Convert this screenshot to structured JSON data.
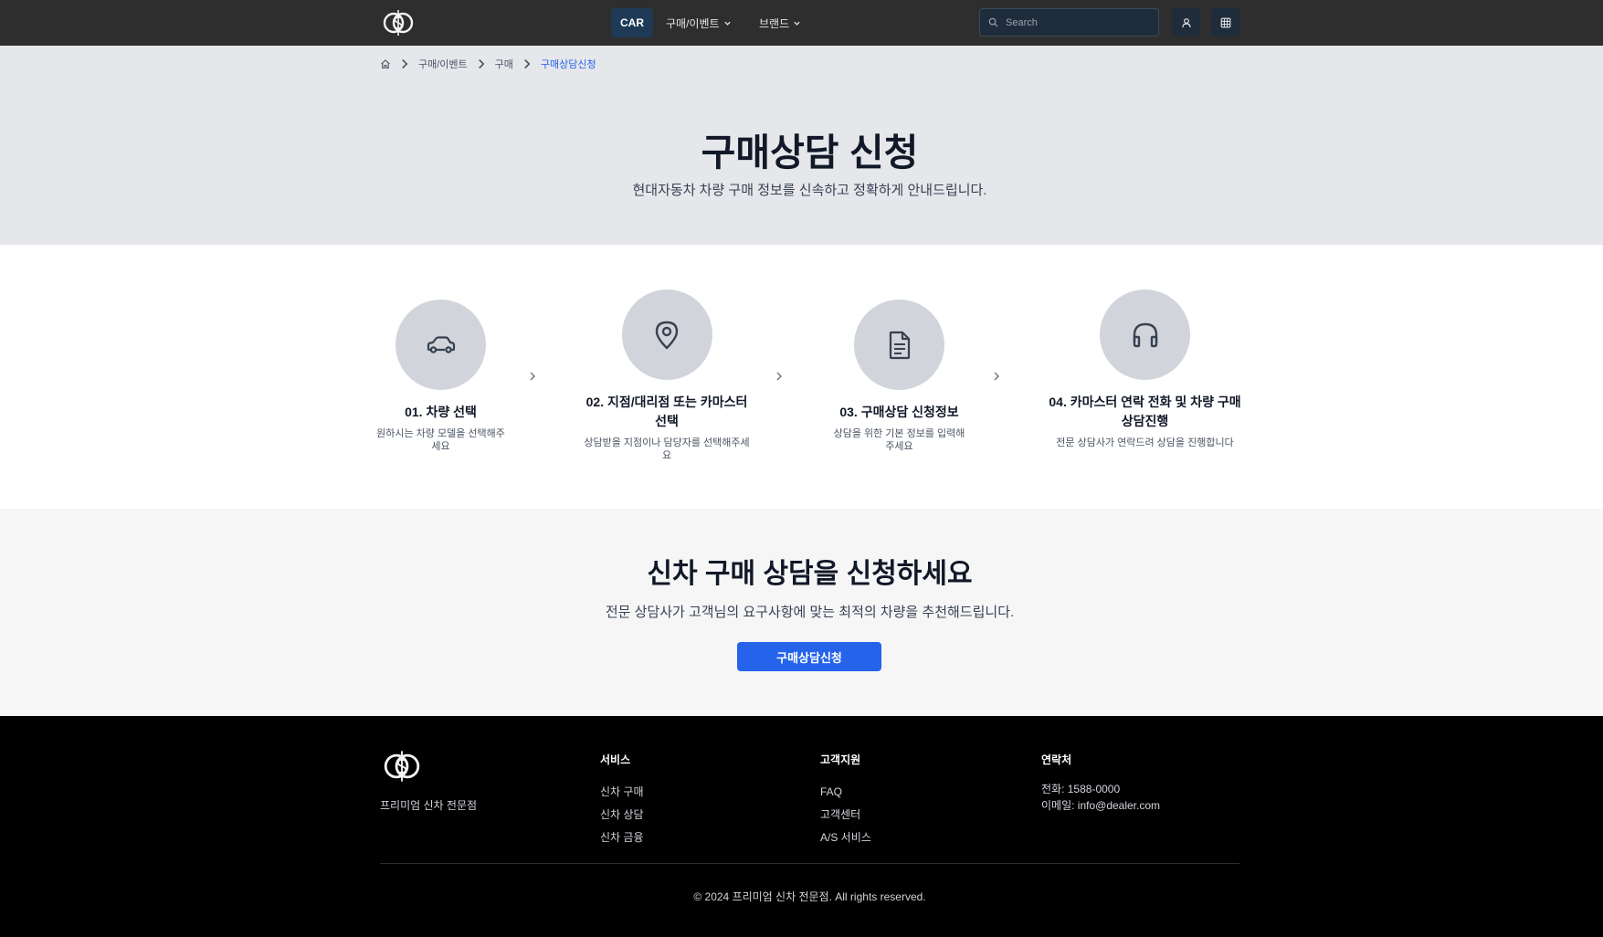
{
  "header": {
    "logo_name": "dollar-seal-logo",
    "nav": [
      {
        "label": "CAR",
        "active": true
      },
      {
        "label": "구매/이벤트",
        "dropdown": true
      },
      {
        "label": "브랜드",
        "dropdown": true
      }
    ],
    "search_placeholder": "Search"
  },
  "breadcrumb": {
    "items": [
      "구매/이벤트",
      "구매"
    ],
    "current": "구매상담신청"
  },
  "hero": {
    "title": "구매상담 신청",
    "subtitle": "현대자동차 차량 구매 정보를 신속하고 정확하게 안내드립니다."
  },
  "steps": [
    {
      "icon": "car-icon",
      "title": "01. 차량 선택",
      "desc": "원하시는 차량 모델을 선택해주세요"
    },
    {
      "icon": "map-pin-icon",
      "title": "02. 지점/대리점 또는 카마스터 선택",
      "desc": "상담받을 지점이나 담당자를 선택해주세요"
    },
    {
      "icon": "document-icon",
      "title": "03. 구매상담 신청정보",
      "desc": "상담을 위한 기본 정보를 입력해주세요"
    },
    {
      "icon": "headphones-icon",
      "title": "04. 카마스터 연락 전화 및 차량 구매 상담진행",
      "desc": "전문 상담사가 연락드려 상담을 진행합니다"
    }
  ],
  "cta": {
    "title": "신차 구매 상담을 신청하세요",
    "subtitle": "전문 상담사가 고객님의 요구사항에 맞는 최적의 차량을 추천해드립니다.",
    "button": "구매상담신청"
  },
  "footer": {
    "tagline": "프리미엄 신차 전문점",
    "services": {
      "heading": "서비스",
      "links": [
        "신차 구매",
        "신차 상담",
        "신차 금융"
      ]
    },
    "support": {
      "heading": "고객지원",
      "links": [
        "FAQ",
        "고객센터",
        "A/S 서비스"
      ]
    },
    "contact": {
      "heading": "연락처",
      "phone": "전화: 1588-0000",
      "email": "이메일: info@dealer.com"
    },
    "copyright": "© 2024 프리미엄 신차 전문점. All rights reserved."
  },
  "colors": {
    "header_bg": "#2e2e2e",
    "accent": "#2563eb",
    "hero_bg": "#e6e7eb",
    "footer_bg": "#000000"
  }
}
